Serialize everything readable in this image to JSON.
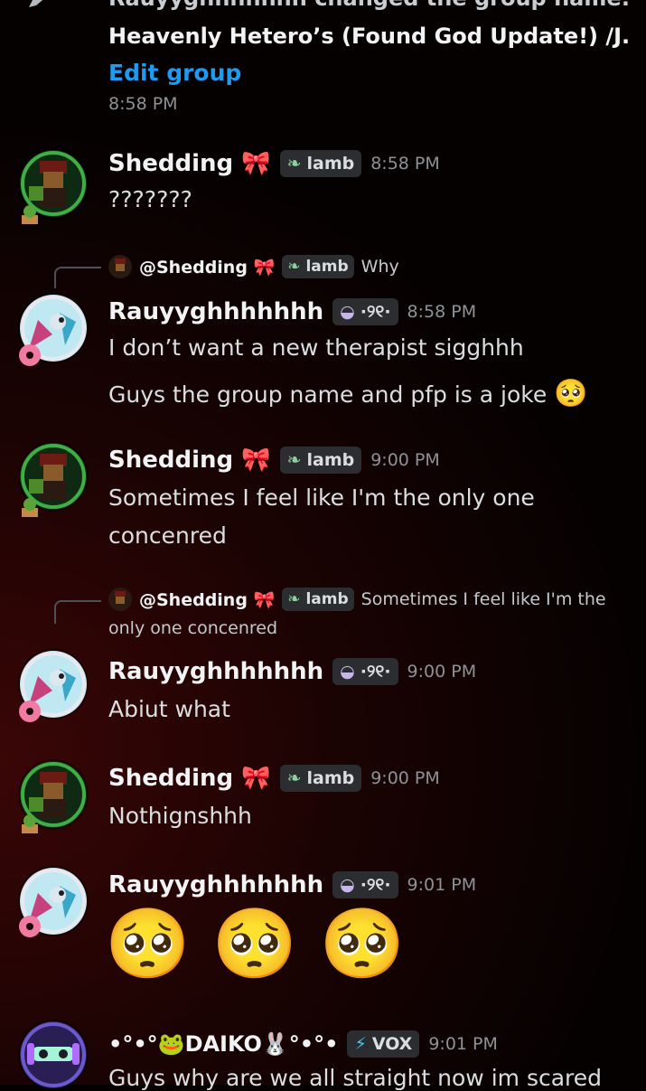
{
  "system": {
    "header_partial": "Rauyyghhhhhhh changed the group name:",
    "group_name": "Heavenly Hetero’s (Found God Update!) /J.",
    "edit_link": "Edit group",
    "time": "8:58 PM"
  },
  "colors": {
    "link": "#1e9bf0",
    "timestamp": "#8e9297",
    "name": "#f2f3f5"
  },
  "users": {
    "shedding": {
      "name": "Shedding",
      "name_emoji": "🎀",
      "tag_icon": "leaf-icon",
      "tag": "lamb"
    },
    "rauyy": {
      "name": "Rauyyghhhhhhh",
      "tag_icon": "lavender-badge-icon",
      "tag": "·୨୧·"
    },
    "daiko": {
      "name": "•°•°🐸DAIKO🐰°•°•",
      "tag_icon": "bolt-icon",
      "tag": "VOX"
    }
  },
  "messages": [
    {
      "user": "shedding",
      "time": "8:58 PM",
      "lines": [
        "???????"
      ]
    },
    {
      "user": "rauyy",
      "time": "8:58 PM",
      "reply": {
        "mention": "@Shedding",
        "mention_emoji": "🎀",
        "tag": "lamb",
        "text": "Why"
      },
      "lines": [
        "I don’t want a new therapist sigghhh",
        "Guys the group name and pfp is a joke"
      ],
      "line_emoji": "🥺"
    },
    {
      "user": "shedding",
      "time": "9:00 PM",
      "lines": [
        "Sometimes I feel like I'm the only one",
        "concenred"
      ]
    },
    {
      "user": "rauyy",
      "time": "9:00 PM",
      "reply": {
        "mention": "@Shedding",
        "mention_emoji": "🎀",
        "tag": "lamb",
        "text": "Sometimes I feel like I'm the",
        "text2": "only one concenred"
      },
      "lines": [
        "Abiut what"
      ]
    },
    {
      "user": "shedding",
      "time": "9:00 PM",
      "lines": [
        "Nothignshhh"
      ]
    },
    {
      "user": "rauyy",
      "time": "9:01 PM",
      "emojis": [
        "🥺",
        "🥺",
        "🥺"
      ]
    },
    {
      "user": "daiko",
      "time": "9:01 PM",
      "lines": [
        "Guys why are we all straight now im scared"
      ]
    }
  ]
}
